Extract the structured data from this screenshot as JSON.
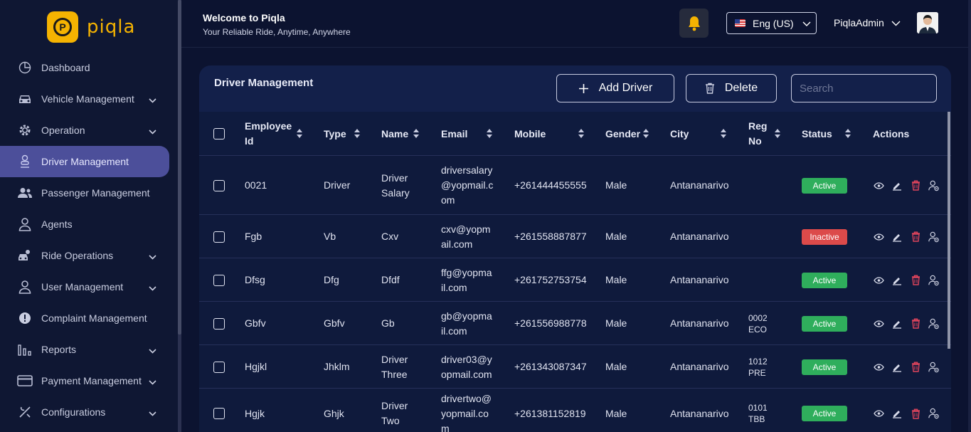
{
  "brand": {
    "name": "piqla",
    "badge_letter": "P",
    "color": "#f5b301"
  },
  "sidebar": {
    "items": [
      {
        "label": "Dashboard",
        "icon": "dashboard-icon",
        "has_chevron": false,
        "active": false
      },
      {
        "label": "Vehicle Management",
        "icon": "car-icon",
        "has_chevron": true,
        "active": false
      },
      {
        "label": "Operation",
        "icon": "gear-icon",
        "has_chevron": true,
        "active": false
      },
      {
        "label": "Driver Management",
        "icon": "driver-icon",
        "has_chevron": false,
        "active": true
      },
      {
        "label": "Passenger Management",
        "icon": "users-icon",
        "has_chevron": false,
        "active": false
      },
      {
        "label": "Agents",
        "icon": "user-icon",
        "has_chevron": false,
        "active": false
      },
      {
        "label": "Ride Operations",
        "icon": "ride-icon",
        "has_chevron": true,
        "active": false
      },
      {
        "label": "User Management",
        "icon": "user-icon",
        "has_chevron": true,
        "active": false
      },
      {
        "label": "Complaint Management",
        "icon": "alert-icon",
        "has_chevron": false,
        "active": false
      },
      {
        "label": "Reports",
        "icon": "bar-chart-icon",
        "has_chevron": true,
        "active": false
      },
      {
        "label": "Payment Management",
        "icon": "card-icon",
        "has_chevron": true,
        "active": false
      },
      {
        "label": "Configurations",
        "icon": "tools-icon",
        "has_chevron": true,
        "active": false
      }
    ]
  },
  "header": {
    "welcome": "Welcome to Piqla",
    "tagline": "Your Reliable Ride, Anytime, Anywhere",
    "language": "Eng (US)",
    "username": "PiqlaAdmin"
  },
  "card": {
    "title": "Driver Management",
    "add_label": "Add Driver",
    "delete_label": "Delete",
    "search_placeholder": "Search"
  },
  "table": {
    "headers": {
      "employee_id": [
        "Employee",
        "Id"
      ],
      "type": "Type",
      "name": "Name",
      "email": "Email",
      "mobile": "Mobile",
      "gender": "Gender",
      "city": "City",
      "reg_no": [
        "Reg",
        "No"
      ],
      "status": "Status",
      "actions": "Actions"
    },
    "rows": [
      {
        "employee_id": "0021",
        "type": "Driver",
        "name": [
          "Driver",
          "Salary"
        ],
        "email": [
          "driversalary",
          "@yopmail.c",
          "om"
        ],
        "mobile": "+261444455555",
        "gender": "Male",
        "city": "Antananarivo",
        "reg_no": [
          "",
          ""
        ],
        "status": "Active"
      },
      {
        "employee_id": "Fgb",
        "type": "Vb",
        "name": [
          "Cxv"
        ],
        "email": [
          "cxv@yopm",
          "ail.com"
        ],
        "mobile": "+261558887877",
        "gender": "Male",
        "city": "Antananarivo",
        "reg_no": [
          "",
          ""
        ],
        "status": "Inactive"
      },
      {
        "employee_id": "Dfsg",
        "type": "Dfg",
        "name": [
          "Dfdf"
        ],
        "email": [
          "ffg@yopma",
          "il.com"
        ],
        "mobile": "+261752753754",
        "gender": "Male",
        "city": "Antananarivo",
        "reg_no": [
          "",
          ""
        ],
        "status": "Active"
      },
      {
        "employee_id": "Gbfv",
        "type": "Gbfv",
        "name": [
          "Gb"
        ],
        "email": [
          "gb@yopma",
          "il.com"
        ],
        "mobile": "+261556988778",
        "gender": "Male",
        "city": "Antananarivo",
        "reg_no": [
          "0002",
          "ECO"
        ],
        "status": "Active"
      },
      {
        "employee_id": "Hgjkl",
        "type": "Jhklm",
        "name": [
          "Driver",
          "Three"
        ],
        "email": [
          "driver03@y",
          "opmail.com"
        ],
        "mobile": "+261343087347",
        "gender": "Male",
        "city": "Antananarivo",
        "reg_no": [
          "1012",
          "PRE"
        ],
        "status": "Active"
      },
      {
        "employee_id": "Hgjk",
        "type": "Ghjk",
        "name": [
          "Driver",
          "Two"
        ],
        "email": [
          "drivertwo@",
          "yopmail.co",
          "m"
        ],
        "mobile": "+261381152819",
        "gender": "Male",
        "city": "Antananarivo",
        "reg_no": [
          "0101",
          "TBB"
        ],
        "status": "Active"
      }
    ]
  },
  "colors": {
    "active": "#2fae5c",
    "inactive": "#dc4a4a",
    "delete_icon": "#e0445c",
    "nav_active": "#4c4f9a"
  }
}
